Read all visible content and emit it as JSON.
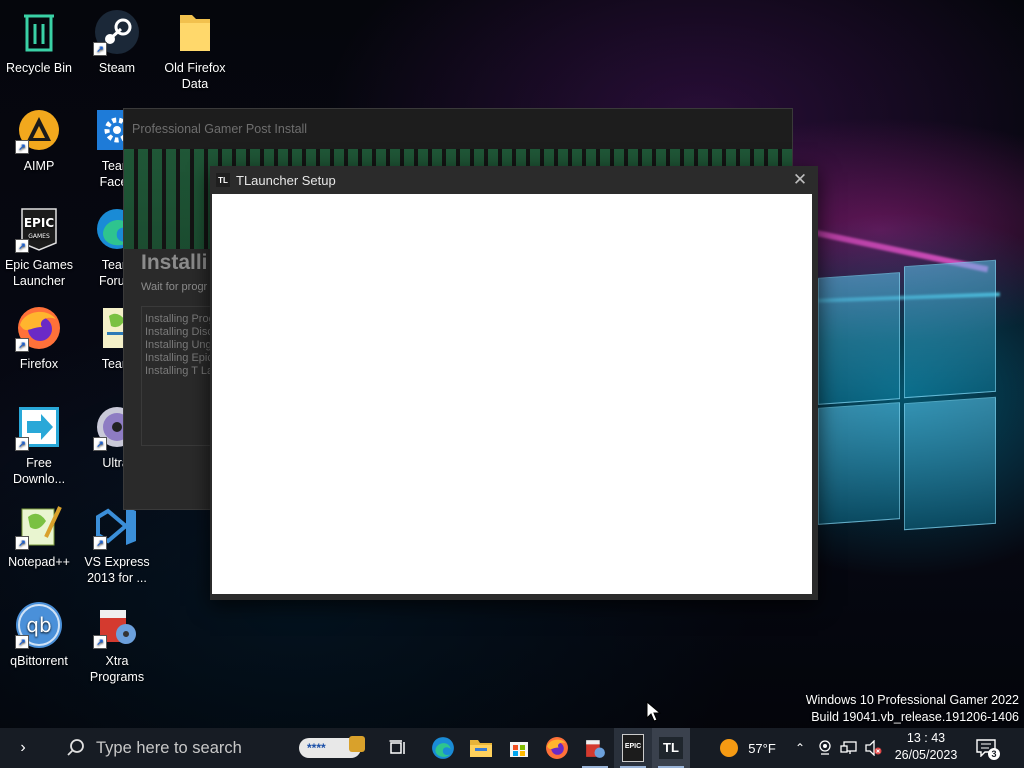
{
  "desktop": {
    "icons": [
      {
        "label": "Recycle Bin"
      },
      {
        "label": "Steam"
      },
      {
        "label": "Old Firefox\nData"
      },
      {
        "label": "AIMP"
      },
      {
        "label": "Team\nFaceb"
      },
      {
        "label": "Epic Games\nLauncher"
      },
      {
        "label": "Team\nForum"
      },
      {
        "label": "Firefox"
      },
      {
        "label": "Team"
      },
      {
        "label": "Free\nDownlo..."
      },
      {
        "label": "Ultral"
      },
      {
        "label": "Notepad++"
      },
      {
        "label": "VS Express\n2013 for ..."
      },
      {
        "label": "qBittorrent"
      },
      {
        "label": "Xtra\nPrograms"
      }
    ]
  },
  "background_window": {
    "title": "Professional Gamer Post Install",
    "heading": "Installi",
    "subtitle": "Wait for progr",
    "log_lines": [
      "Installing Prog",
      "Installing Disc",
      "Installing Ung",
      "Installing Epic",
      "Installing T La"
    ]
  },
  "setup_window": {
    "title": "TLauncher Setup",
    "icon_text": "TL",
    "close_glyph": "✕"
  },
  "watermark": {
    "line1": "Windows 10 Professional Gamer 2022",
    "line2": "Build 19041.vb_release.191206-1406"
  },
  "taskbar": {
    "search_placeholder": "Type here to search",
    "password_text": "****",
    "epic_text": "EPIC",
    "tl_text": "TL",
    "weather": "57°F",
    "time": "13 : 43",
    "date": "26/05/2023",
    "notification_count": "3"
  }
}
